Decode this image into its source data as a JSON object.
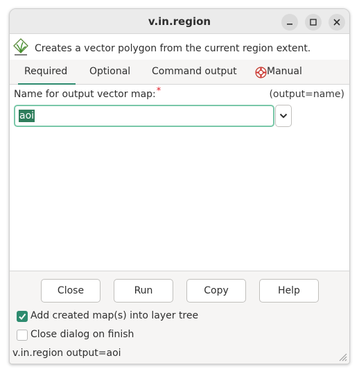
{
  "window": {
    "title": "v.in.region"
  },
  "description": "Creates a vector polygon from the current region extent.",
  "tabs": [
    {
      "label": "Required"
    },
    {
      "label": "Optional"
    },
    {
      "label": "Command output"
    },
    {
      "label": "Manual"
    }
  ],
  "field": {
    "label": "Name for output vector map:",
    "required_mark": "*",
    "hint": "(output=name)",
    "value": "aoi"
  },
  "buttons": {
    "close": "Close",
    "run": "Run",
    "copy": "Copy",
    "help": "Help"
  },
  "options": {
    "add_to_tree": {
      "label": "Add created map(s) into layer tree",
      "checked": true
    },
    "close_on_finish": {
      "label": "Close dialog on finish",
      "checked": false
    }
  },
  "status": "v.in.region output=aoi",
  "colors": {
    "accent": "#2e8b6f",
    "selection": "#2e7d5b",
    "focus_border": "#79c7a8",
    "required": "#e01b24"
  }
}
